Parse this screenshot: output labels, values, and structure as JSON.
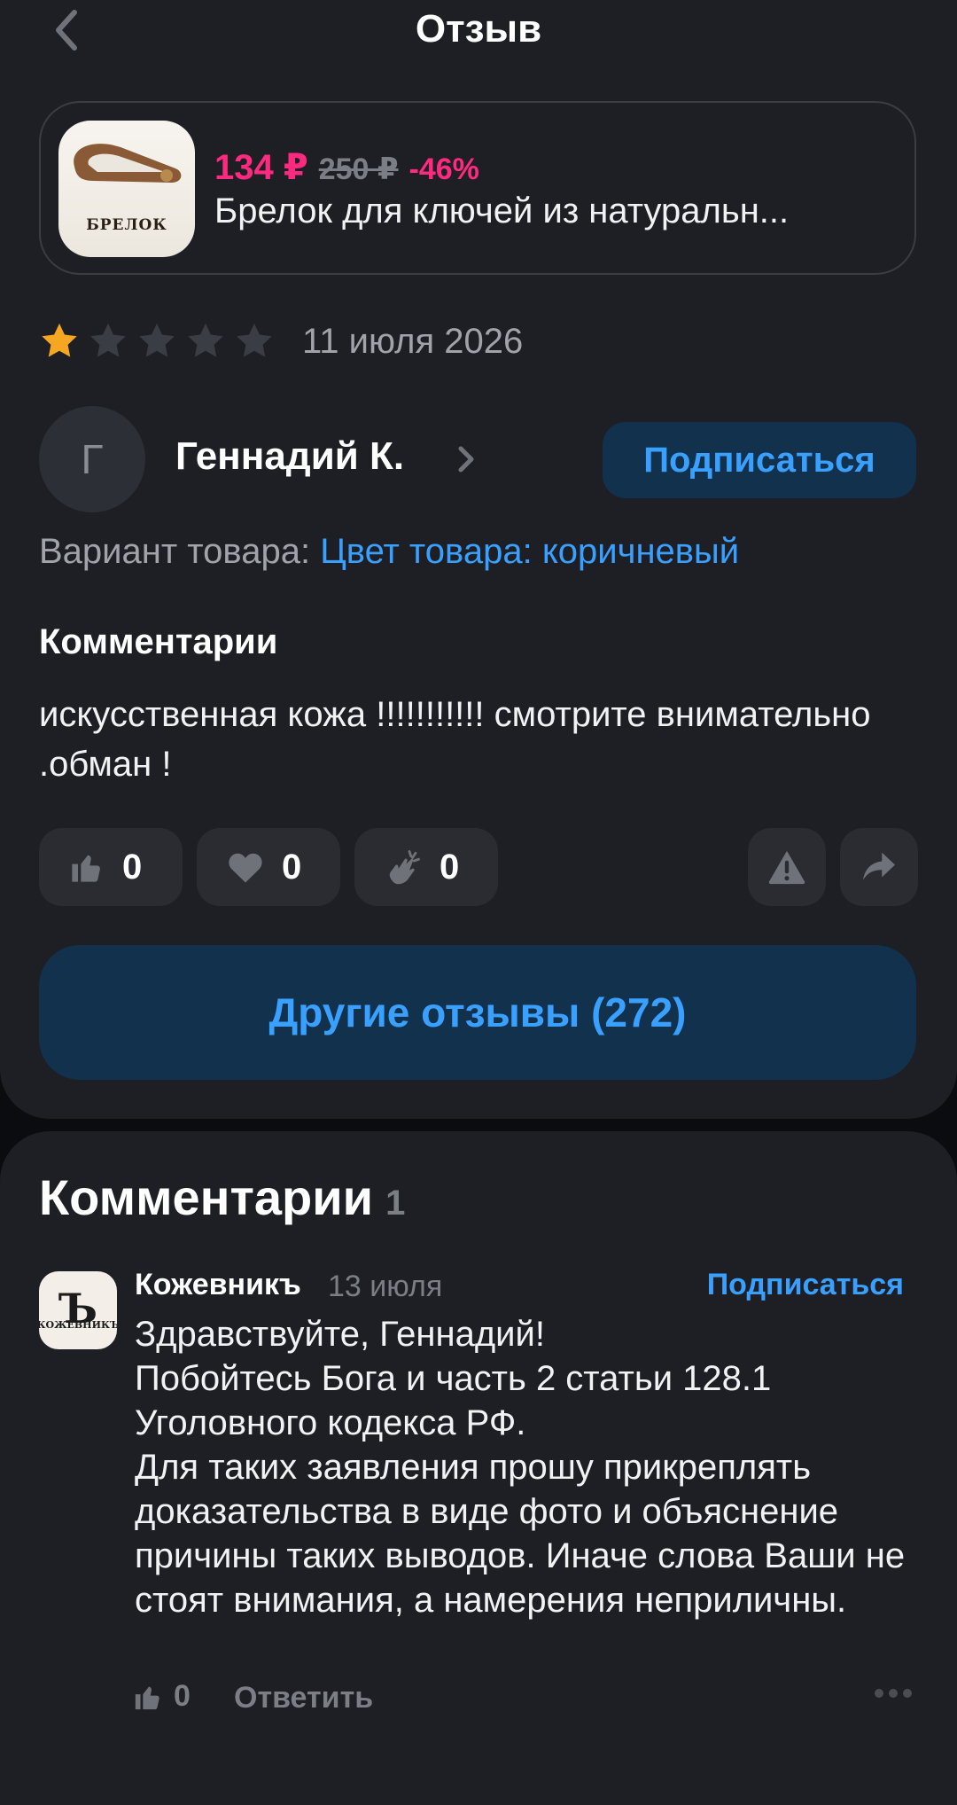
{
  "header": {
    "title": "Отзыв"
  },
  "product": {
    "image_label": "БРЕЛОК",
    "price_now": "134 ₽",
    "price_old": "250 ₽",
    "discount": "-46%",
    "name": "Брелок для ключей из натуральн..."
  },
  "review": {
    "rating": 1,
    "rating_max": 5,
    "date": "11 июля 2026",
    "author": {
      "initial": "Г",
      "name": "Геннадий К."
    },
    "subscribe_label": "Подписаться",
    "variant_label": "Вариант товара:",
    "variant_value": "Цвет товара: коричневый",
    "comments_heading": "Комментарии",
    "text": "искусственная кожа !!!!!!!!!!! смотрите внимательно .обман !",
    "reactions": [
      {
        "icon": "thumbs-up-icon",
        "count": "0"
      },
      {
        "icon": "heart-icon",
        "count": "0"
      },
      {
        "icon": "clap-icon",
        "count": "0"
      }
    ],
    "other_reviews_label": "Другие отзывы (272)"
  },
  "comments_section": {
    "title": "Комментарии",
    "count": "1",
    "items": [
      {
        "author": "Кожевникъ",
        "avatar_letter": "Ъ",
        "avatar_text": "КОЖЕВНИКЪ",
        "date": "13 июля",
        "subscribe_label": "Подписаться",
        "text": "Здравствуйте, Геннадий!\nПобойтесь Бога и часть 2 статьи 128.1 Уголовного кодекса РФ.\nДля таких заявления прошу прикреплять доказательства в виде фото и объяснение причины таких выводов. Иначе слова Ваши не стоят внимания, а намерения неприличны.",
        "likes": "0",
        "reply_label": "Ответить"
      }
    ]
  },
  "colors": {
    "background": "#1d1f24",
    "accent_blue": "#3aa0ff",
    "price_pink": "#ff2a7f",
    "star_active": "#f5a623",
    "star_inactive": "#3a3d44"
  }
}
